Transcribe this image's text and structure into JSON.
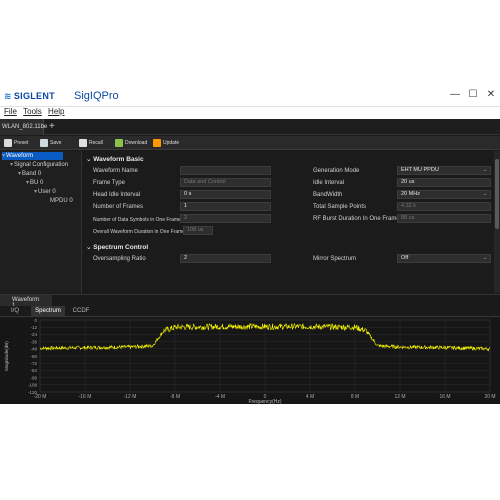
{
  "window": {
    "brand": "SIGLENT",
    "app_name": "SigIQPro",
    "controls": {
      "minimize": "—",
      "maximize": "☐",
      "close": "✕"
    }
  },
  "menu": [
    "File",
    "Tools",
    "Help"
  ],
  "doc_tab": {
    "label": "WLAN_802.11be",
    "add": "+"
  },
  "toolbar": [
    {
      "label": "Preset",
      "icon": "preset-icon",
      "color": "#dddddd"
    },
    {
      "label": "Save",
      "icon": "save-icon",
      "color": "#dddddd"
    },
    {
      "label": "Recall",
      "icon": "recall-icon",
      "color": "#dddddd"
    },
    {
      "label": "Download",
      "icon": "download-icon",
      "color": "#8bc34a"
    },
    {
      "label": "Update",
      "icon": "update-icon",
      "color": "#ff9800"
    }
  ],
  "tree": [
    {
      "label": "Waveform",
      "level": 0,
      "selected": true
    },
    {
      "label": "Signal Configuration",
      "level": 1,
      "selected": false
    },
    {
      "label": "Band 0",
      "level": 2,
      "selected": false
    },
    {
      "label": "BU 0",
      "level": 3,
      "selected": false
    },
    {
      "label": "User 0",
      "level": 4,
      "selected": false
    },
    {
      "label": "MPDU 0",
      "level": 5,
      "selected": false
    }
  ],
  "waveform_basic": {
    "title": "Waveform Basic",
    "left": [
      {
        "label": "Waveform Name",
        "value": "",
        "dim": false
      },
      {
        "label": "Frame Type",
        "value": "Data and Control",
        "dim": true
      },
      {
        "label": "Head Idle Interval",
        "value": "0 s",
        "dim": false
      },
      {
        "label": "Number of Frames",
        "value": "1",
        "dim": false
      },
      {
        "label": "Number of Data Symbols in One Frame",
        "value": "2",
        "dim": true
      },
      {
        "label": "Overall Waveform Duration in One Frame",
        "value": "108 us",
        "dim": true
      }
    ],
    "right": [
      {
        "label": "Generation Mode",
        "value": "EHT MU PPDU",
        "dim": false,
        "dropdown": true
      },
      {
        "label": "Idle Interval",
        "value": "20 us",
        "dim": false,
        "dropdown": false
      },
      {
        "label": "BandWidth",
        "value": "20 MHz",
        "dim": false,
        "dropdown": true
      },
      {
        "label": "Total Sample Points",
        "value": "4.32 k",
        "dim": true,
        "dropdown": false
      },
      {
        "label": "RF Burst Duration In One Frame",
        "value": "88 us",
        "dim": true,
        "dropdown": false
      }
    ]
  },
  "spectrum_control": {
    "title": "Spectrum Control",
    "left_label": "Oversampling Ratio",
    "left_value": "2",
    "right_label": "Mirror Spectrum",
    "right_value": "Off"
  },
  "wave_tab": "Waveform 1",
  "sub_tabs": [
    {
      "label": "I/Q",
      "active": false
    },
    {
      "label": "Spectrum",
      "active": true
    },
    {
      "label": "CCDF",
      "active": false
    }
  ],
  "chart_data": {
    "type": "line",
    "xlabel": "Frequency(Hz)",
    "ylabel": "Magnitude(dB)",
    "x_ticks": [
      "-20 M",
      "-16 M",
      "-12 M",
      "-8 M",
      "-4 M",
      "0",
      "4 M",
      "8 M",
      "12 M",
      "16 M",
      "20 M"
    ],
    "y_ticks": [
      "0",
      "-12",
      "-24",
      "-36",
      "-48",
      "-60",
      "-72",
      "-84",
      "-96",
      "-108",
      "-120"
    ],
    "xlim": [
      -20,
      20
    ],
    "ylim": [
      -120,
      0
    ],
    "line_color": "#ffff00",
    "grid": true,
    "series": [
      {
        "x": [
          -20,
          -16,
          -12,
          -10,
          -9.8,
          -9,
          -8,
          -4,
          0,
          4,
          8,
          9,
          9.8,
          10,
          12,
          16,
          20
        ],
        "y": [
          -47,
          -46,
          -45,
          -43,
          -38,
          -18,
          -12,
          -11,
          -11,
          -11,
          -12,
          -18,
          -38,
          -43,
          -45,
          -46,
          -48
        ]
      }
    ]
  }
}
